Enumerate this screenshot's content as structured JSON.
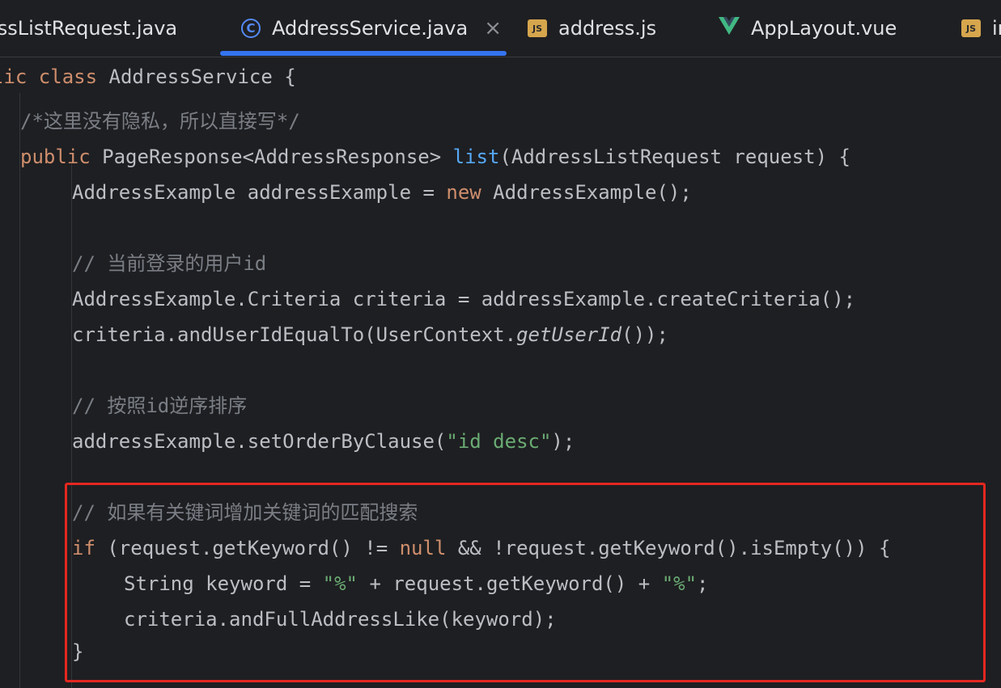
{
  "tabs": [
    {
      "label": "essListRequest.java",
      "icon": "java-class-icon",
      "active": false
    },
    {
      "label": "AddressService.java",
      "icon": "class-c-icon",
      "active": true
    },
    {
      "label": "address.js",
      "icon": "js-file-icon",
      "active": false
    },
    {
      "label": "AppLayout.vue",
      "icon": "vue-icon",
      "active": false
    },
    {
      "label": "ir",
      "icon": "js-file-icon",
      "active": false
    }
  ],
  "tab_close_glyph": "×",
  "js_icon_text": "JS",
  "c_icon_text": "C",
  "code": {
    "line1": {
      "a": "lic ",
      "b": "class",
      "c": " AddressService {"
    },
    "line2": {
      "a": "/*这里没有隐私，所以直接写*/"
    },
    "line3": {
      "a": "public",
      "b": " PageResponse<AddressResponse> ",
      "c": "list",
      "d": "(AddressListRequest request) {"
    },
    "line4": {
      "a": "AddressExample addressExample = ",
      "b": "new",
      "c": " AddressExample();"
    },
    "line5": {
      "a": "// 当前登录的用户id"
    },
    "line6": {
      "a": "AddressExample.Criteria criteria = addressExample.createCriteria();"
    },
    "line7": {
      "a": "criteria.andUserIdEqualTo(UserContext.",
      "b": "getUserId",
      "c": "());"
    },
    "line8": {
      "a": "// 按照id逆序排序"
    },
    "line9": {
      "a": "addressExample.setOrderByClause(",
      "b": "\"id desc\"",
      "c": ");"
    },
    "line10": {
      "a": "// 如果有关键词增加关键词的匹配搜索"
    },
    "line11": {
      "a": "if",
      "b": " (request.getKeyword() != ",
      "c": "null",
      "d": " && !request.getKeyword().isEmpty()) {"
    },
    "line12": {
      "a": "String keyword = ",
      "b": "\"%\"",
      "c": " + request.getKeyword() + ",
      "d": "\"%\"",
      "e": ";"
    },
    "line13": {
      "a": "criteria.andFullAddressLike(keyword);"
    },
    "line14": {
      "a": "}"
    }
  },
  "colors": {
    "background": "#1e1f22",
    "text": "#bcbec4",
    "keyword": "#cf8e6d",
    "method": "#56a8f5",
    "string": "#6aab73",
    "comment": "#7a7e85",
    "tab_accent": "#3574f0",
    "highlight_box": "#e42720"
  }
}
